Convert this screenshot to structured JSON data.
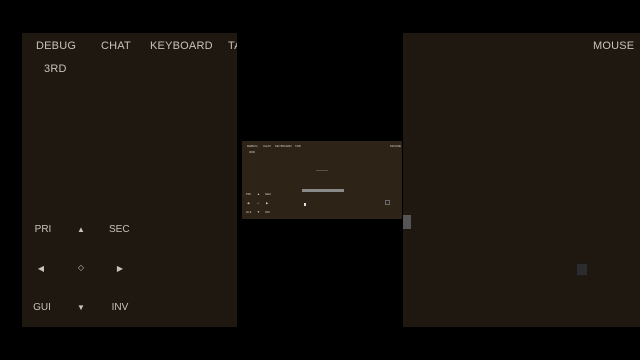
{
  "top_bar": {
    "debug": "DEBUG",
    "chat": "CHAT",
    "keyboard": "KEYBOARD",
    "tab_partial": "TA",
    "mode": "3RD",
    "mouse": "MOUSE"
  },
  "controls": {
    "pri": "PRI",
    "sec": "SEC",
    "up": "▲",
    "down": "▼",
    "left": "◀",
    "right": "▶",
    "center": "◇",
    "gui": "GUI",
    "inv": "INV"
  },
  "preview": {
    "debug": "DEBUG",
    "chat": "CHAT",
    "keyboard": "KEYBOARD",
    "tab": "TAB",
    "mouse": "MOUSE",
    "mode": "3RD",
    "pri": "PRI",
    "sec": "SEC",
    "gui": "GUI",
    "inv": "INV",
    "up": "▲",
    "down": "▼",
    "left": "◀",
    "right": "▶",
    "center": "◇"
  },
  "colors": {
    "panel": "#1e1810",
    "preview_bg": "#2d2317",
    "text": "#c9c2b8"
  }
}
